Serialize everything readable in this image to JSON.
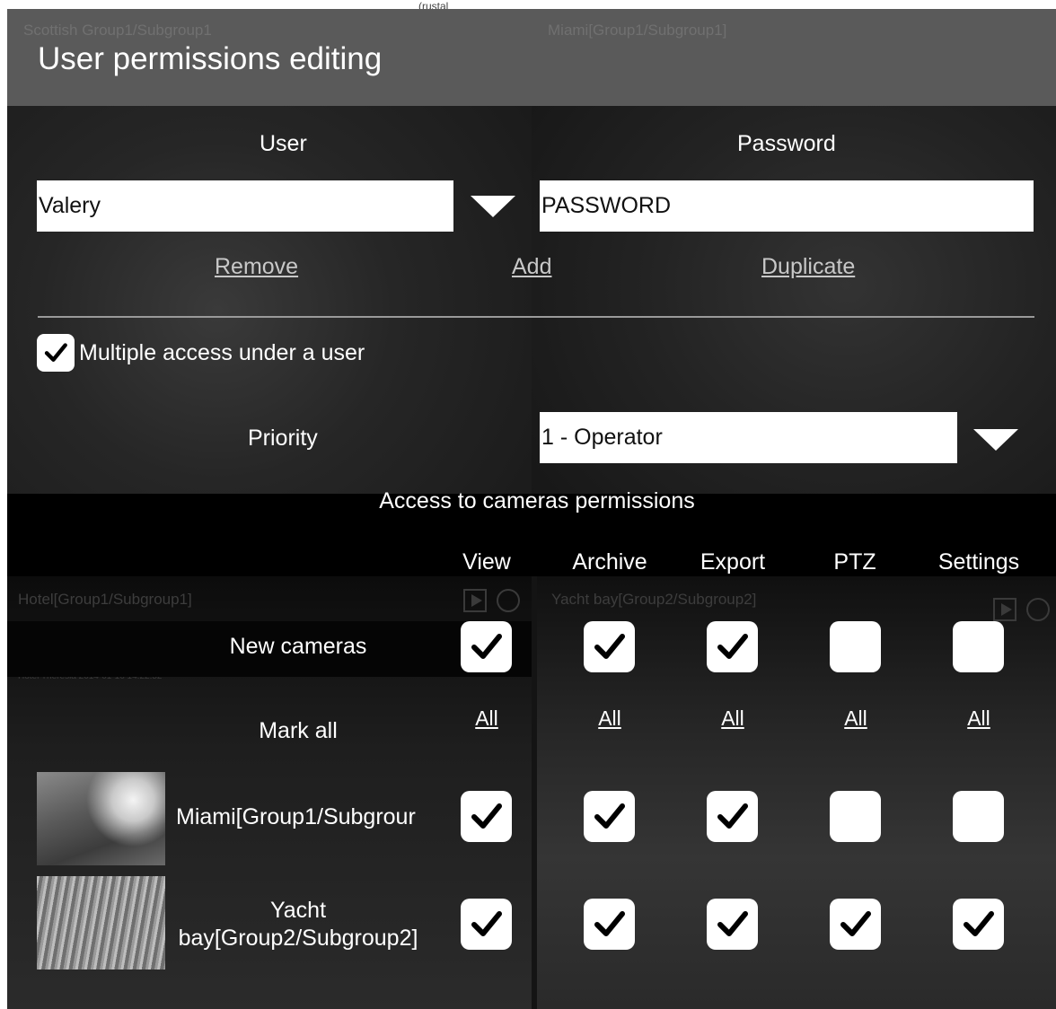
{
  "window": {
    "title": "User permissions editing",
    "top_fragment": "(rustal",
    "ghost_left": "Scottish Group1/Subgroup1",
    "ghost_right": "Miami[Group1/Subgroup1]"
  },
  "background_tiles": {
    "hotel_caption": "Hotel[Group1/Subgroup1]",
    "yacht_caption": "Yacht bay[Group2/Subgroup2]",
    "hotel_meta": "Hotel Theresia 2014-01-16 14:22:52"
  },
  "user": {
    "label": "User",
    "value": "Valery",
    "actions": {
      "remove": "Remove",
      "add": "Add",
      "duplicate": "Duplicate"
    }
  },
  "password": {
    "label": "Password",
    "value": "PASSWORD"
  },
  "multiple_access": {
    "label": "Multiple access under a user",
    "checked": true
  },
  "priority": {
    "label": "Priority",
    "value": "1 - Operator"
  },
  "camera_permissions": {
    "title": "Access to cameras permissions",
    "columns": [
      "View",
      "Archive",
      "Export",
      "PTZ",
      "Settings"
    ],
    "all_label": "All",
    "mark_all_label": "Mark all",
    "rows": [
      {
        "name": "New cameras",
        "checks": [
          true,
          true,
          true,
          false,
          false
        ]
      },
      {
        "name": "Miami[Group1/Subgroup1]",
        "display": "Miami[Group1/Subgrour",
        "thumbnail": "miami-camera",
        "checks": [
          true,
          true,
          true,
          false,
          false
        ]
      },
      {
        "name_line1": "Yacht",
        "name_line2": "bay[Group2/Subgroup2]",
        "thumbnail": "yacht-camera",
        "checks": [
          true,
          true,
          true,
          true,
          true
        ]
      }
    ]
  },
  "colors": {
    "header": "#5a5a5a",
    "panel": "#141414",
    "checkbox": "#ffffff",
    "check": "#000000"
  }
}
